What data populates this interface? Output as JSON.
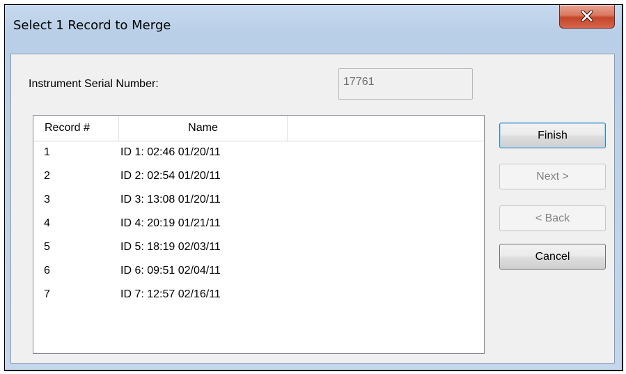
{
  "dialog": {
    "title": "Select 1 Record to Merge"
  },
  "serial": {
    "label": "Instrument Serial Number:",
    "value": "17761"
  },
  "list": {
    "columns": {
      "record": "Record #",
      "name": "Name",
      "extra": ""
    },
    "rows": [
      {
        "num": "1",
        "name": "ID 1: 02:46 01/20/11"
      },
      {
        "num": "2",
        "name": "ID 2: 02:54 01/20/11"
      },
      {
        "num": "3",
        "name": "ID 3: 13:08 01/20/11"
      },
      {
        "num": "4",
        "name": "ID 4: 20:19 01/21/11"
      },
      {
        "num": "5",
        "name": "ID 5: 18:19 02/03/11"
      },
      {
        "num": "6",
        "name": "ID 6: 09:51 02/04/11"
      },
      {
        "num": "7",
        "name": "ID 7: 12:57 02/16/11"
      }
    ]
  },
  "buttons": {
    "finish": "Finish",
    "next": "Next >",
    "back": "< Back",
    "cancel": "Cancel"
  },
  "icons": {
    "close": "close-icon"
  },
  "colors": {
    "title_bar": "#c4d7ec",
    "close_button": "#c4452a",
    "default_button_border": "#3c7fb1",
    "disabled_text": "#838383"
  }
}
